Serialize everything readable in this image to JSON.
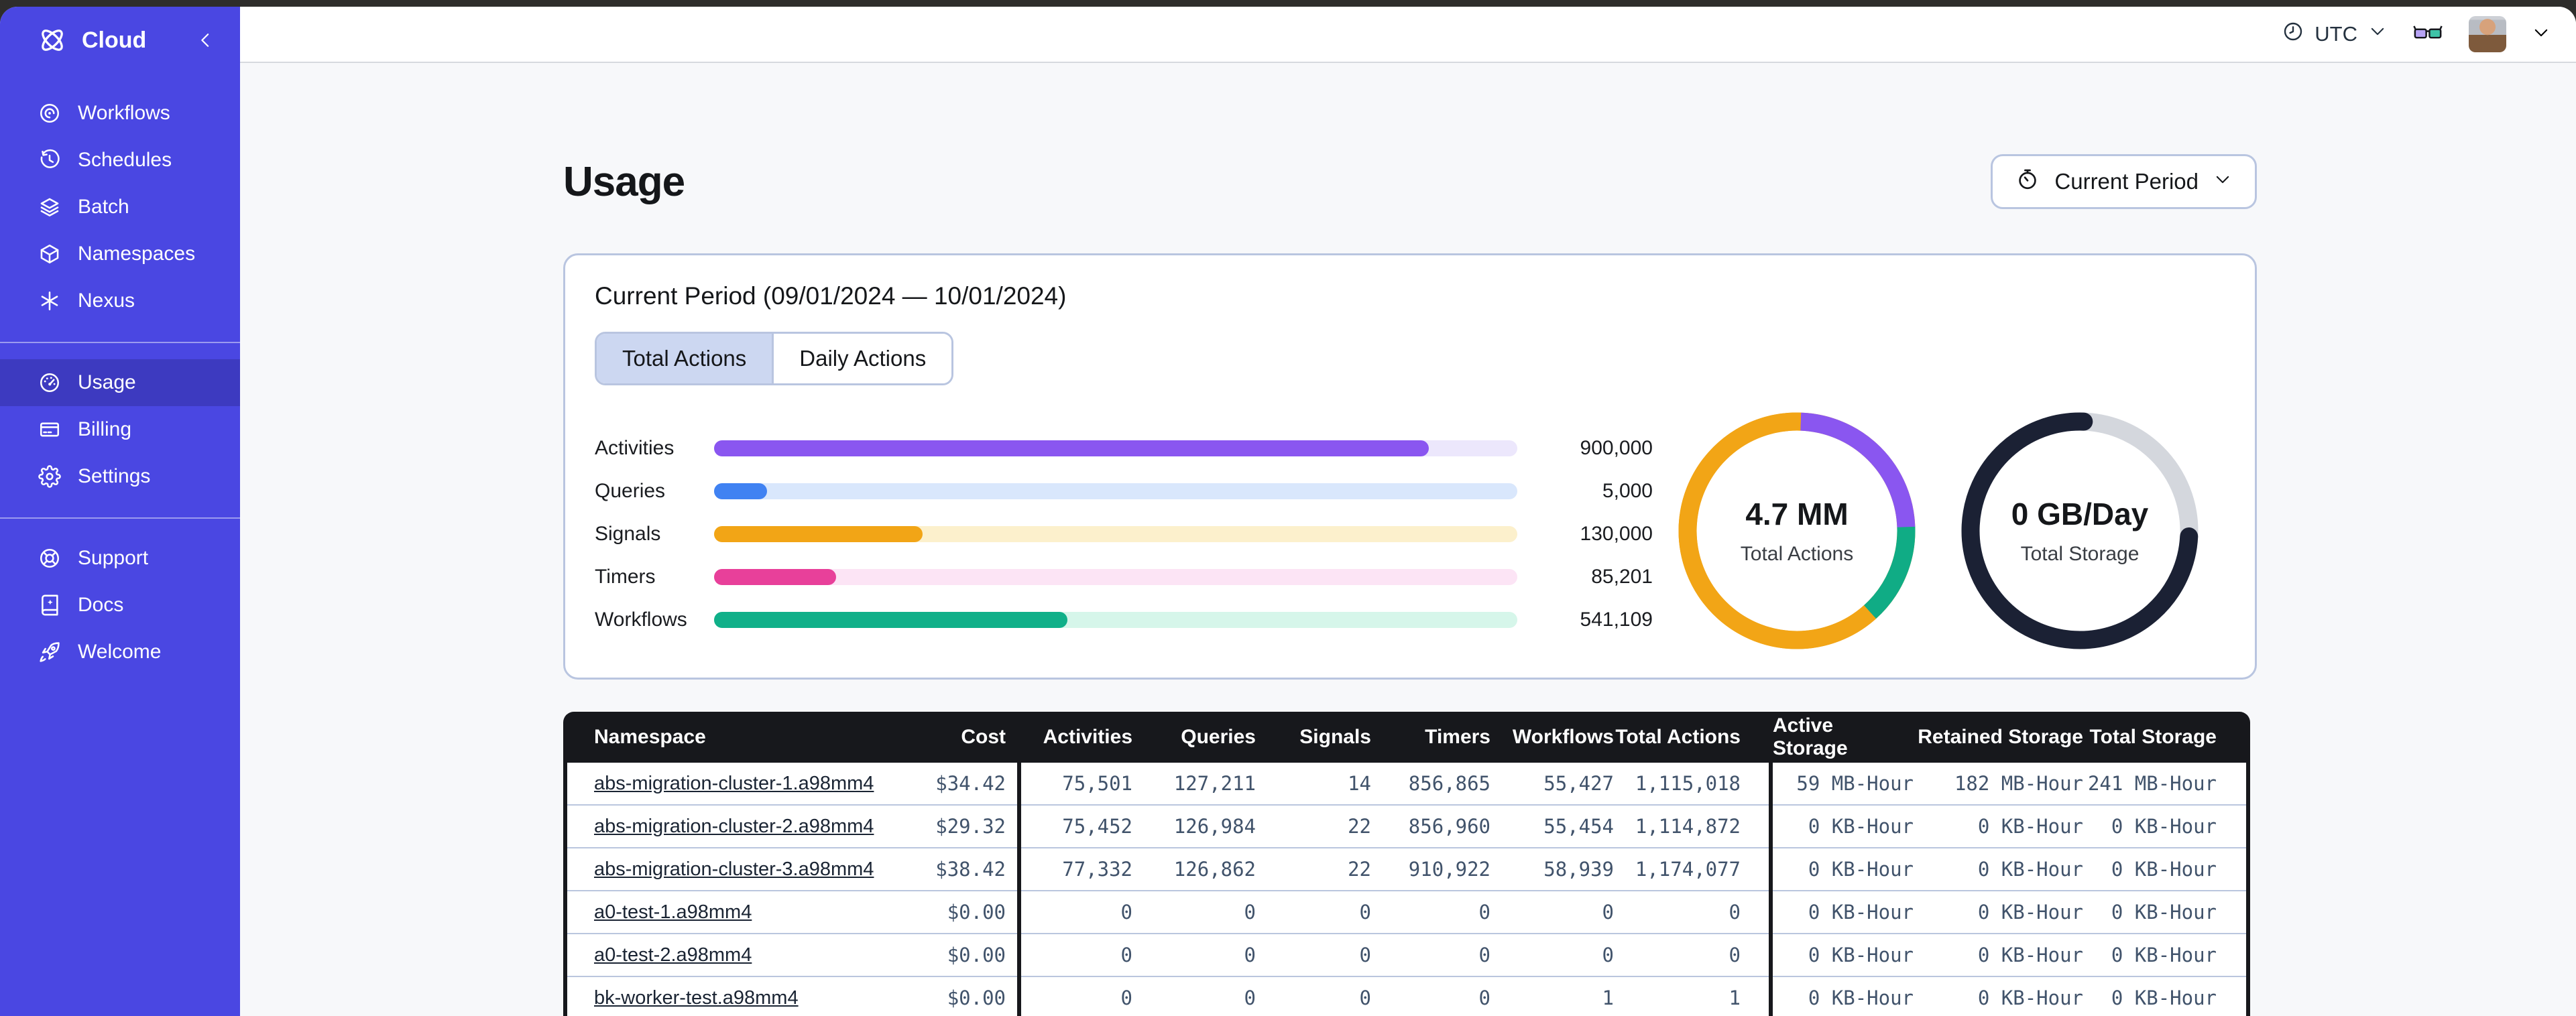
{
  "sidebar": {
    "brand": {
      "label": "Cloud",
      "icon": "temporal-logo",
      "collapse_icon": "chevron-left-icon"
    },
    "sections": [
      {
        "name": "platform",
        "items": [
          {
            "id": "workflows",
            "label": "Workflows",
            "icon": "workflows-icon",
            "selected": false
          },
          {
            "id": "schedules",
            "label": "Schedules",
            "icon": "schedules-icon",
            "selected": false
          },
          {
            "id": "batch",
            "label": "Batch",
            "icon": "batch-icon",
            "selected": false
          },
          {
            "id": "namespaces",
            "label": "Namespaces",
            "icon": "namespaces-icon",
            "selected": false
          },
          {
            "id": "nexus",
            "label": "Nexus",
            "icon": "nexus-icon",
            "selected": false
          }
        ]
      },
      {
        "name": "account",
        "items": [
          {
            "id": "usage",
            "label": "Usage",
            "icon": "usage-icon",
            "selected": true
          },
          {
            "id": "billing",
            "label": "Billing",
            "icon": "billing-icon",
            "selected": false
          },
          {
            "id": "settings",
            "label": "Settings",
            "icon": "settings-icon",
            "selected": false
          }
        ]
      },
      {
        "name": "help",
        "items": [
          {
            "id": "support",
            "label": "Support",
            "icon": "support-icon",
            "selected": false
          },
          {
            "id": "docs",
            "label": "Docs",
            "icon": "docs-icon",
            "selected": false
          },
          {
            "id": "welcome",
            "label": "Welcome",
            "icon": "welcome-icon",
            "selected": false
          }
        ]
      }
    ],
    "colors": {
      "bg": "#4a47e2",
      "selected_bg": "#3d3ac0"
    }
  },
  "topbar": {
    "timezone_label": "UTC",
    "icons": [
      "clock-icon",
      "chevron-down-icon",
      "glasses-icon",
      "avatar",
      "chevron-down-icon"
    ]
  },
  "page": {
    "title": "Usage",
    "period_selector_label": "Current Period"
  },
  "usage_card": {
    "title": "Current Period (09/01/2024 — 10/01/2024)",
    "tabs": [
      {
        "label": "Total Actions",
        "selected": true
      },
      {
        "label": "Daily Actions",
        "selected": false
      }
    ]
  },
  "chart_data": [
    {
      "type": "bar",
      "title": "Actions by type (current period)",
      "categories": [
        "Activities",
        "Queries",
        "Signals",
        "Timers",
        "Workflows"
      ],
      "values": [
        900000,
        5000,
        130000,
        85201,
        541109
      ],
      "display_values": [
        "900,000",
        "5,000",
        "130,000",
        "85,201",
        "541,109"
      ],
      "fill_percents": [
        89,
        6.6,
        26,
        15.2,
        44
      ],
      "fill_colors": [
        "#8a56f0",
        "#4082f2",
        "#f2a516",
        "#e8409a",
        "#10b089"
      ],
      "track_colors": [
        "#ece7fc",
        "#d9e7fc",
        "#fcf0cc",
        "#fce4f5",
        "#d6f6ea"
      ]
    },
    {
      "type": "donut",
      "center_value": "4.7 MM",
      "center_label": "Total Actions",
      "base_color": "#f2a516",
      "cap": "butt",
      "segments": [
        {
          "name": "activities",
          "color": "#8a56f0",
          "start_deg": 2,
          "percent": 23.9
        },
        {
          "name": "workflows",
          "color": "#10ac85",
          "start_deg": 88,
          "percent": 13.9
        },
        {
          "name": "other",
          "color": "#f2a516",
          "start_deg": 138,
          "percent": 62.2
        }
      ]
    },
    {
      "type": "donut",
      "center_value": "0 GB/Day",
      "center_label": "Total Storage",
      "base_color": "#d4d7dd",
      "cap": "round",
      "segments": [
        {
          "name": "storage-used",
          "color": "#1b2134",
          "start_deg": 93,
          "percent": 74.7
        }
      ]
    }
  ],
  "usage_table": {
    "columns": [
      "Namespace",
      "Cost",
      "Activities",
      "Queries",
      "Signals",
      "Timers",
      "Workflows",
      "Total Actions",
      "Active Storage",
      "Retained Storage",
      "Total Storage"
    ],
    "rows": [
      [
        "abs-migration-cluster-1.a98mm4",
        "$34.42",
        "75,501",
        "127,211",
        "14",
        "856,865",
        "55,427",
        "1,115,018",
        "59 MB-Hour",
        "182 MB-Hour",
        "241 MB-Hour"
      ],
      [
        "abs-migration-cluster-2.a98mm4",
        "$29.32",
        "75,452",
        "126,984",
        "22",
        "856,960",
        "55,454",
        "1,114,872",
        "0 KB-Hour",
        "0 KB-Hour",
        "0 KB-Hour"
      ],
      [
        "abs-migration-cluster-3.a98mm4",
        "$38.42",
        "77,332",
        "126,862",
        "22",
        "910,922",
        "58,939",
        "1,174,077",
        "0 KB-Hour",
        "0 KB-Hour",
        "0 KB-Hour"
      ],
      [
        "a0-test-1.a98mm4",
        "$0.00",
        "0",
        "0",
        "0",
        "0",
        "0",
        "0",
        "0 KB-Hour",
        "0 KB-Hour",
        "0 KB-Hour"
      ],
      [
        "a0-test-2.a98mm4",
        "$0.00",
        "0",
        "0",
        "0",
        "0",
        "0",
        "0",
        "0 KB-Hour",
        "0 KB-Hour",
        "0 KB-Hour"
      ],
      [
        "bk-worker-test.a98mm4",
        "$0.00",
        "0",
        "0",
        "0",
        "0",
        "1",
        "1",
        "0 KB-Hour",
        "0 KB-Hour",
        "0 KB-Hour"
      ]
    ]
  }
}
